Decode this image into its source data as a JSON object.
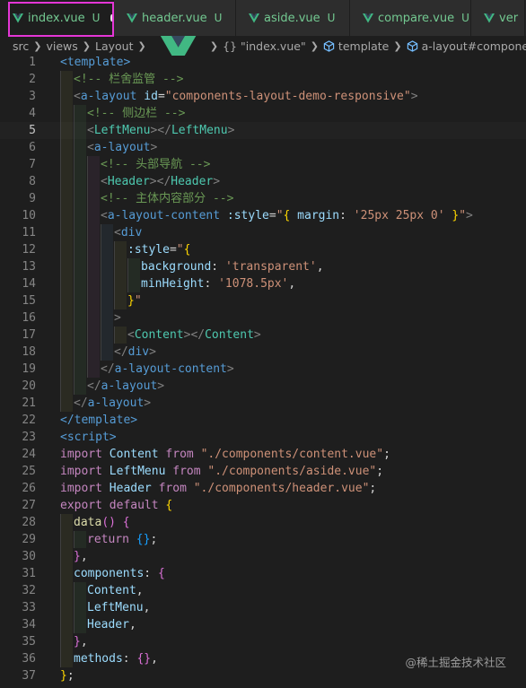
{
  "tabs": [
    {
      "name": "index.vue",
      "status": "U",
      "active": true,
      "modified": true
    },
    {
      "name": "header.vue",
      "status": "U",
      "active": false,
      "modified": false
    },
    {
      "name": "aside.vue",
      "status": "U",
      "active": false,
      "modified": false
    },
    {
      "name": "compare.vue",
      "status": "U",
      "active": false,
      "modified": false
    },
    {
      "name": "ver",
      "status": "",
      "active": false,
      "modified": false
    }
  ],
  "breadcrumb": {
    "items": [
      "src",
      "views",
      "Layout",
      "index.vue",
      "\"index.vue\"",
      "template",
      "a-layout#components-la"
    ],
    "braces": "{}"
  },
  "editor": {
    "current_line": 5,
    "lines": [
      {
        "n": "1",
        "indent": 0,
        "tokens": [
          [
            "tag",
            "<template>"
          ]
        ]
      },
      {
        "n": "2",
        "indent": 1,
        "tokens": [
          [
            "cm",
            "<!-- 栏舍监管 -->"
          ]
        ]
      },
      {
        "n": "3",
        "indent": 1,
        "tokens": [
          [
            "br",
            "<"
          ],
          [
            "tag",
            "a-layout"
          ],
          [
            "plain",
            " "
          ],
          [
            "attr",
            "id"
          ],
          [
            "plain",
            "="
          ],
          [
            "str",
            "\"components-layout-demo-responsive\""
          ],
          [
            "br",
            ">"
          ]
        ]
      },
      {
        "n": "4",
        "indent": 2,
        "tokens": [
          [
            "cm",
            "<!-- 侧边栏 -->"
          ]
        ]
      },
      {
        "n": "5",
        "indent": 2,
        "tokens": [
          [
            "br",
            "<"
          ],
          [
            "tagc",
            "LeftMenu"
          ],
          [
            "br",
            "></"
          ],
          [
            "tagc",
            "LeftMenu"
          ],
          [
            "br",
            ">"
          ]
        ]
      },
      {
        "n": "6",
        "indent": 2,
        "tokens": [
          [
            "br",
            "<"
          ],
          [
            "tag",
            "a-layout"
          ],
          [
            "br",
            ">"
          ]
        ]
      },
      {
        "n": "7",
        "indent": 3,
        "tokens": [
          [
            "cm",
            "<!-- 头部导航 -->"
          ]
        ]
      },
      {
        "n": "8",
        "indent": 3,
        "tokens": [
          [
            "br",
            "<"
          ],
          [
            "tagc",
            "Header"
          ],
          [
            "br",
            "></"
          ],
          [
            "tagc",
            "Header"
          ],
          [
            "br",
            ">"
          ]
        ]
      },
      {
        "n": "9",
        "indent": 3,
        "tokens": [
          [
            "cm",
            "<!-- 主体内容部分 -->"
          ]
        ]
      },
      {
        "n": "10",
        "indent": 3,
        "tokens": [
          [
            "br",
            "<"
          ],
          [
            "tag",
            "a-layout-content"
          ],
          [
            "plain",
            " "
          ],
          [
            "attr",
            ":style"
          ],
          [
            "plain",
            "="
          ],
          [
            "str",
            "\""
          ],
          [
            "b1",
            "{"
          ],
          [
            "plain",
            " "
          ],
          [
            "id",
            "margin"
          ],
          [
            "plain",
            ": "
          ],
          [
            "str",
            "'25px 25px 0'"
          ],
          [
            "plain",
            " "
          ],
          [
            "b1",
            "}"
          ],
          [
            "str",
            "\""
          ],
          [
            "br",
            ">"
          ]
        ]
      },
      {
        "n": "11",
        "indent": 4,
        "tokens": [
          [
            "br",
            "<"
          ],
          [
            "tag",
            "div"
          ]
        ]
      },
      {
        "n": "12",
        "indent": 5,
        "tokens": [
          [
            "attr",
            ":style"
          ],
          [
            "plain",
            "="
          ],
          [
            "str",
            "\""
          ],
          [
            "b1",
            "{"
          ]
        ]
      },
      {
        "n": "13",
        "indent": 6,
        "tokens": [
          [
            "id",
            "background"
          ],
          [
            "plain",
            ": "
          ],
          [
            "str",
            "'transparent'"
          ],
          [
            "plain",
            ","
          ]
        ]
      },
      {
        "n": "14",
        "indent": 6,
        "tokens": [
          [
            "id",
            "minHeight"
          ],
          [
            "plain",
            ": "
          ],
          [
            "str",
            "'1078.5px'"
          ],
          [
            "plain",
            ","
          ]
        ]
      },
      {
        "n": "15",
        "indent": 5,
        "tokens": [
          [
            "b1",
            "}"
          ],
          [
            "str",
            "\""
          ]
        ]
      },
      {
        "n": "16",
        "indent": 4,
        "tokens": [
          [
            "br",
            ">"
          ]
        ]
      },
      {
        "n": "17",
        "indent": 5,
        "tokens": [
          [
            "br",
            "<"
          ],
          [
            "tagc",
            "Content"
          ],
          [
            "br",
            "></"
          ],
          [
            "tagc",
            "Content"
          ],
          [
            "br",
            ">"
          ]
        ]
      },
      {
        "n": "18",
        "indent": 4,
        "tokens": [
          [
            "br",
            "</"
          ],
          [
            "tag",
            "div"
          ],
          [
            "br",
            ">"
          ]
        ]
      },
      {
        "n": "19",
        "indent": 3,
        "tokens": [
          [
            "br",
            "</"
          ],
          [
            "tag",
            "a-layout-content"
          ],
          [
            "br",
            ">"
          ]
        ]
      },
      {
        "n": "20",
        "indent": 2,
        "tokens": [
          [
            "br",
            "</"
          ],
          [
            "tag",
            "a-layout"
          ],
          [
            "br",
            ">"
          ]
        ]
      },
      {
        "n": "21",
        "indent": 1,
        "tokens": [
          [
            "br",
            "</"
          ],
          [
            "tag",
            "a-layout"
          ],
          [
            "br",
            ">"
          ]
        ]
      },
      {
        "n": "22",
        "indent": 0,
        "tokens": [
          [
            "tag",
            "</template>"
          ]
        ]
      },
      {
        "n": "23",
        "indent": 0,
        "tokens": [
          [
            "tag",
            "<script>"
          ]
        ]
      },
      {
        "n": "24",
        "indent": 0,
        "tokens": [
          [
            "kw",
            "import"
          ],
          [
            "plain",
            " "
          ],
          [
            "id",
            "Content"
          ],
          [
            "plain",
            " "
          ],
          [
            "kw",
            "from"
          ],
          [
            "plain",
            " "
          ],
          [
            "str",
            "\"./components/content.vue\""
          ],
          [
            "plain",
            ";"
          ]
        ]
      },
      {
        "n": "25",
        "indent": 0,
        "tokens": [
          [
            "kw",
            "import"
          ],
          [
            "plain",
            " "
          ],
          [
            "id",
            "LeftMenu"
          ],
          [
            "plain",
            " "
          ],
          [
            "kw",
            "from"
          ],
          [
            "plain",
            " "
          ],
          [
            "str",
            "\"./components/aside.vue\""
          ],
          [
            "plain",
            ";"
          ]
        ]
      },
      {
        "n": "26",
        "indent": 0,
        "tokens": [
          [
            "kw",
            "import"
          ],
          [
            "plain",
            " "
          ],
          [
            "id",
            "Header"
          ],
          [
            "plain",
            " "
          ],
          [
            "kw",
            "from"
          ],
          [
            "plain",
            " "
          ],
          [
            "str",
            "\"./components/header.vue\""
          ],
          [
            "plain",
            ";"
          ]
        ]
      },
      {
        "n": "27",
        "indent": 0,
        "tokens": [
          [
            "kw",
            "export"
          ],
          [
            "plain",
            " "
          ],
          [
            "kw",
            "default"
          ],
          [
            "plain",
            " "
          ],
          [
            "b1",
            "{"
          ]
        ]
      },
      {
        "n": "28",
        "indent": 1,
        "tokens": [
          [
            "fn",
            "data"
          ],
          [
            "b2",
            "()"
          ],
          [
            "plain",
            " "
          ],
          [
            "b2",
            "{"
          ]
        ]
      },
      {
        "n": "29",
        "indent": 2,
        "tokens": [
          [
            "kw",
            "return"
          ],
          [
            "plain",
            " "
          ],
          [
            "b3",
            "{}"
          ],
          [
            "plain",
            ";"
          ]
        ]
      },
      {
        "n": "30",
        "indent": 1,
        "tokens": [
          [
            "b2",
            "}"
          ],
          [
            "plain",
            ","
          ]
        ]
      },
      {
        "n": "31",
        "indent": 1,
        "tokens": [
          [
            "id",
            "components"
          ],
          [
            "plain",
            ": "
          ],
          [
            "b2",
            "{"
          ]
        ]
      },
      {
        "n": "32",
        "indent": 2,
        "tokens": [
          [
            "id",
            "Content"
          ],
          [
            "plain",
            ","
          ]
        ]
      },
      {
        "n": "33",
        "indent": 2,
        "tokens": [
          [
            "id",
            "LeftMenu"
          ],
          [
            "plain",
            ","
          ]
        ]
      },
      {
        "n": "34",
        "indent": 2,
        "tokens": [
          [
            "id",
            "Header"
          ],
          [
            "plain",
            ","
          ]
        ]
      },
      {
        "n": "35",
        "indent": 1,
        "tokens": [
          [
            "b2",
            "}"
          ],
          [
            "plain",
            ","
          ]
        ]
      },
      {
        "n": "36",
        "indent": 1,
        "tokens": [
          [
            "id",
            "methods"
          ],
          [
            "plain",
            ": "
          ],
          [
            "b2",
            "{}"
          ],
          [
            "plain",
            ","
          ]
        ]
      },
      {
        "n": "37",
        "indent": 0,
        "tokens": [
          [
            "b1",
            "}"
          ],
          [
            "plain",
            ";"
          ]
        ]
      }
    ]
  },
  "watermark": "@稀土掘金技术社区",
  "colors": {
    "highlight": "#e436d6",
    "vue_green": "#41b883",
    "untracked": "#73c991"
  }
}
